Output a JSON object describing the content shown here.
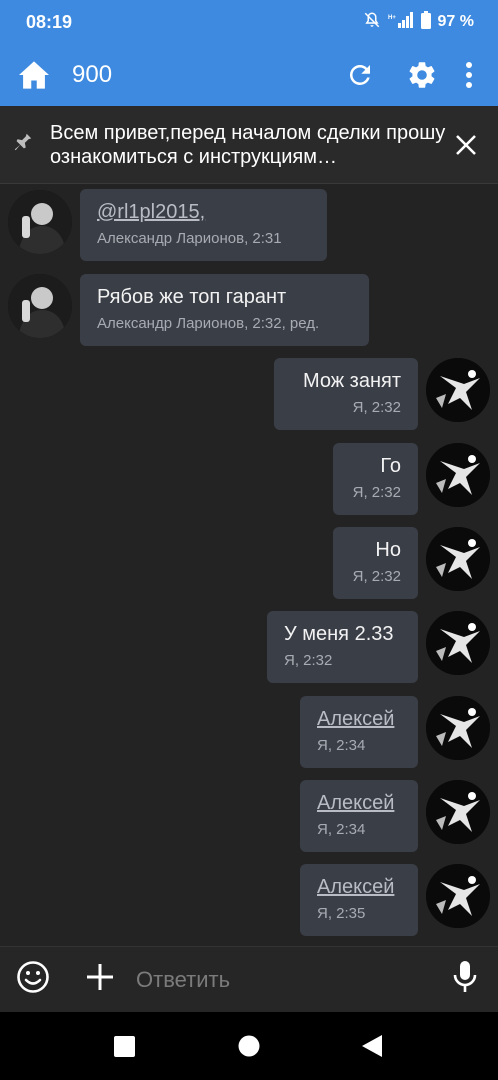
{
  "status": {
    "time": "08:19",
    "battery": "97 %"
  },
  "header": {
    "title": "900"
  },
  "pinned": {
    "text": "Всем привет,перед началом сделки прошу ознакомиться с инструкциям…"
  },
  "messages": [
    {
      "text": "@rl1pl2015,",
      "text_is_link": true,
      "meta": "Александр Ларионов, 2:31",
      "side": "left"
    },
    {
      "text": "Рябов же топ гарант",
      "meta": "Александр Ларионов, 2:32, ред.",
      "side": "left"
    },
    {
      "text": "Мож занят",
      "meta": "Я, 2:32",
      "side": "right"
    },
    {
      "text": "Го",
      "meta": "Я, 2:32",
      "side": "right"
    },
    {
      "text": "Но",
      "meta": "Я, 2:32",
      "side": "right"
    },
    {
      "text": "У меня 2.33",
      "meta": "Я, 2:32",
      "side": "right"
    },
    {
      "text": "Алексей",
      "text_is_link": true,
      "meta": "Я, 2:34",
      "side": "right"
    },
    {
      "text": "Алексей",
      "text_is_link": true,
      "meta": "Я, 2:34",
      "side": "right"
    },
    {
      "text": "Алексей",
      "text_is_link": true,
      "meta": "Я, 2:35",
      "side": "right"
    }
  ],
  "composer": {
    "placeholder": "Ответить"
  },
  "colors": {
    "accent": "#3d8ae0",
    "bubble": "#3a3e47",
    "background": "#232323"
  }
}
